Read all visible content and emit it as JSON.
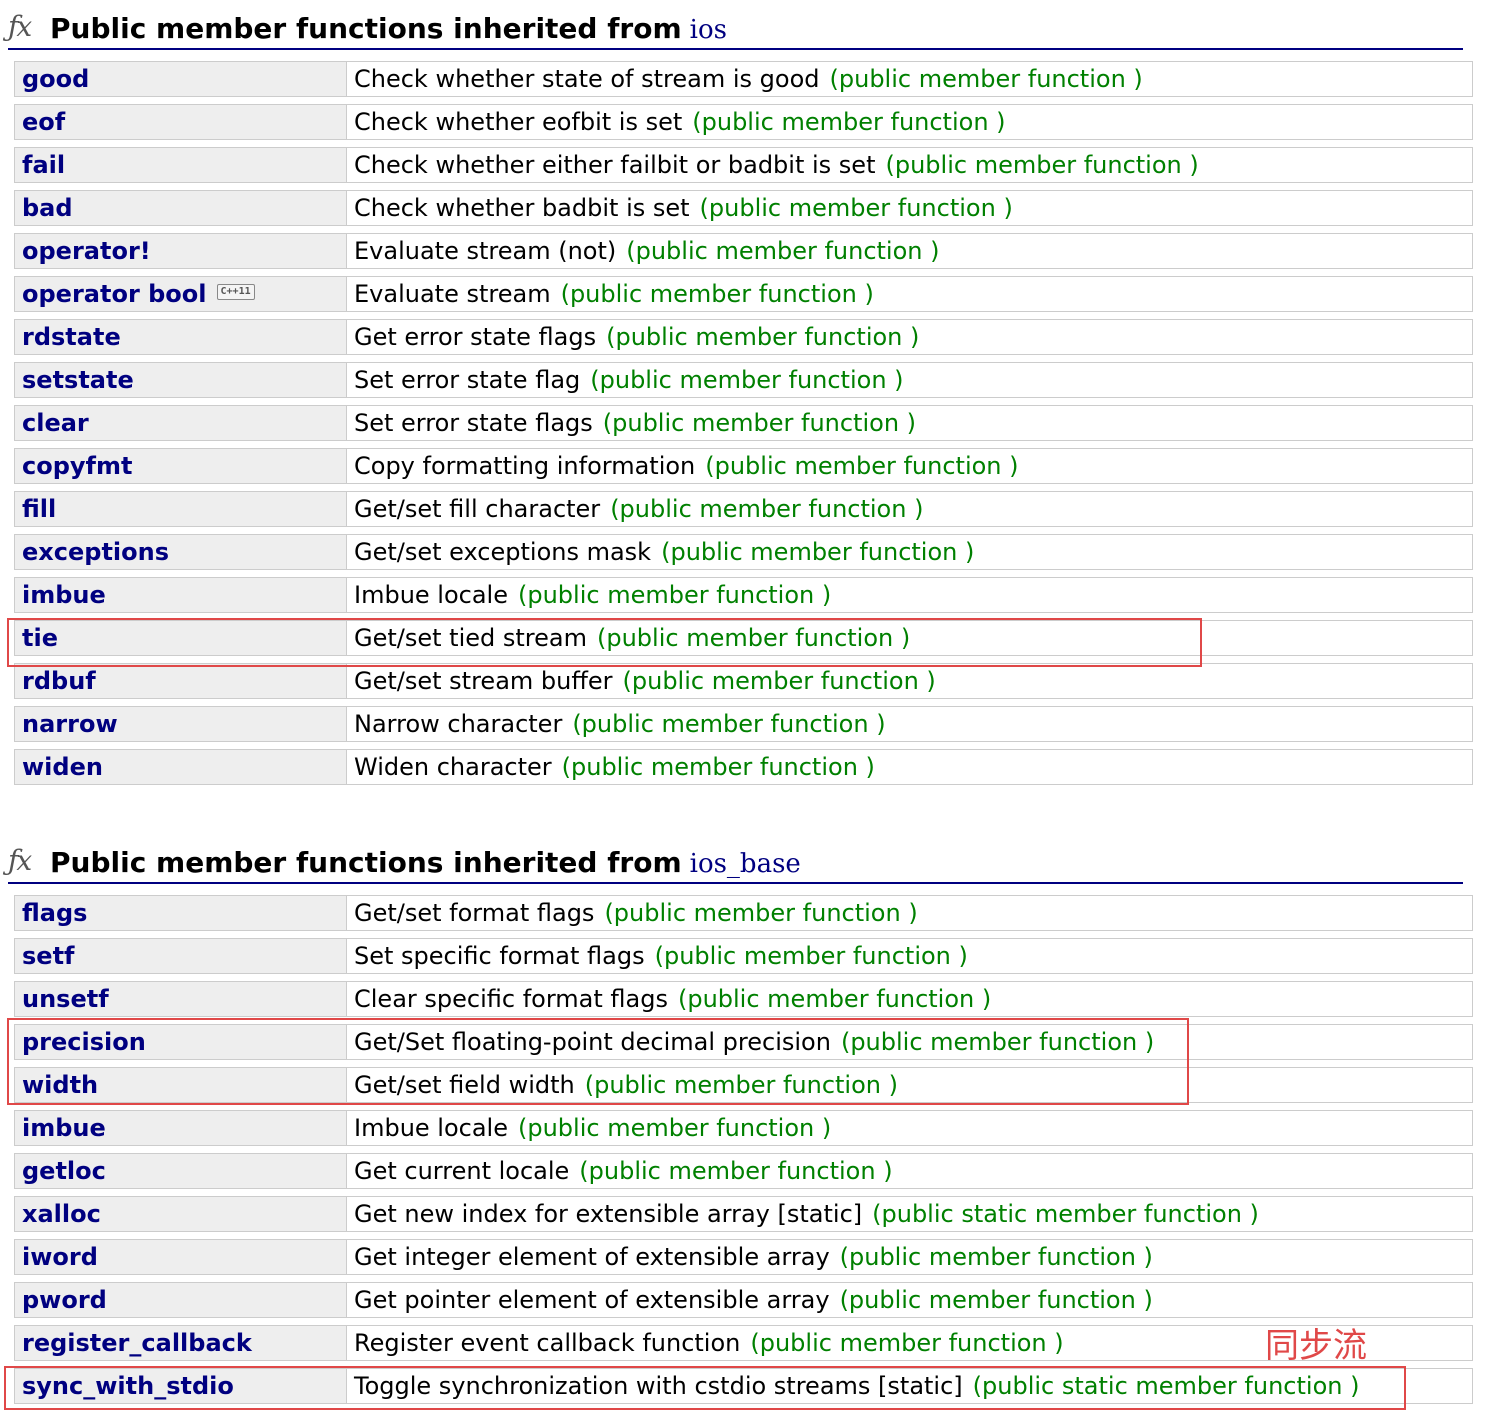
{
  "sections": [
    {
      "title": "Public member functions inherited from",
      "class_name": "ios",
      "rows": [
        {
          "name": "good",
          "desc": "Check whether state of stream is good",
          "kind": "(public member function )"
        },
        {
          "name": "eof",
          "desc": "Check whether eofbit is set",
          "kind": "(public member function )"
        },
        {
          "name": "fail",
          "desc": "Check whether either failbit or badbit is set",
          "kind": "(public member function )"
        },
        {
          "name": "bad",
          "desc": "Check whether badbit is set",
          "kind": "(public member function )"
        },
        {
          "name": "operator!",
          "desc": "Evaluate stream (not)",
          "kind": "(public member function )"
        },
        {
          "name": "operator bool",
          "badge": "C++11",
          "desc": "Evaluate stream",
          "kind": "(public member function )"
        },
        {
          "name": "rdstate",
          "desc": "Get error state flags",
          "kind": "(public member function )"
        },
        {
          "name": "setstate",
          "desc": "Set error state flag",
          "kind": "(public member function )"
        },
        {
          "name": "clear",
          "desc": "Set error state flags",
          "kind": "(public member function )"
        },
        {
          "name": "copyfmt",
          "desc": "Copy formatting information",
          "kind": "(public member function )"
        },
        {
          "name": "fill",
          "desc": "Get/set fill character",
          "kind": "(public member function )"
        },
        {
          "name": "exceptions",
          "desc": "Get/set exceptions mask",
          "kind": "(public member function )"
        },
        {
          "name": "imbue",
          "desc": "Imbue locale",
          "kind": "(public member function )"
        },
        {
          "name": "tie",
          "desc": "Get/set tied stream",
          "kind": "(public member function )"
        },
        {
          "name": "rdbuf",
          "desc": "Get/set stream buffer",
          "kind": "(public member function )"
        },
        {
          "name": "narrow",
          "desc": "Narrow character",
          "kind": "(public member function )"
        },
        {
          "name": "widen",
          "desc": "Widen character",
          "kind": "(public member function )"
        }
      ]
    },
    {
      "title": "Public member functions inherited from",
      "class_name": "ios_base",
      "rows": [
        {
          "name": "flags",
          "desc": "Get/set format flags",
          "kind": "(public member function )"
        },
        {
          "name": "setf",
          "desc": "Set specific format flags",
          "kind": "(public member function )"
        },
        {
          "name": "unsetf",
          "desc": "Clear specific format flags",
          "kind": "(public member function )"
        },
        {
          "name": "precision",
          "desc": "Get/Set floating-point decimal precision",
          "kind": "(public member function )"
        },
        {
          "name": "width",
          "desc": "Get/set field width",
          "kind": "(public member function )"
        },
        {
          "name": "imbue",
          "desc": "Imbue locale",
          "kind": "(public member function )"
        },
        {
          "name": "getloc",
          "desc": "Get current locale",
          "kind": "(public member function )"
        },
        {
          "name": "xalloc",
          "desc": "Get new index for extensible array [static]",
          "kind": "(public static member function )"
        },
        {
          "name": "iword",
          "desc": "Get integer element of extensible array",
          "kind": "(public member function )"
        },
        {
          "name": "pword",
          "desc": "Get pointer element of extensible array",
          "kind": "(public member function )"
        },
        {
          "name": "register_callback",
          "desc": "Register event callback function",
          "kind": "(public member function )"
        },
        {
          "name": "sync_with_stdio",
          "desc": "Toggle synchronization with cstdio streams [static]",
          "kind": "(public static member function )"
        }
      ]
    }
  ],
  "fx_icon": "fx-function-icon",
  "annotation": "同步流",
  "colors": {
    "member_name": "#000080",
    "kind_label": "#008000",
    "highlight": "#e04848",
    "name_cell_bg": "#eeeeee",
    "cell_border": "#cccccc"
  }
}
